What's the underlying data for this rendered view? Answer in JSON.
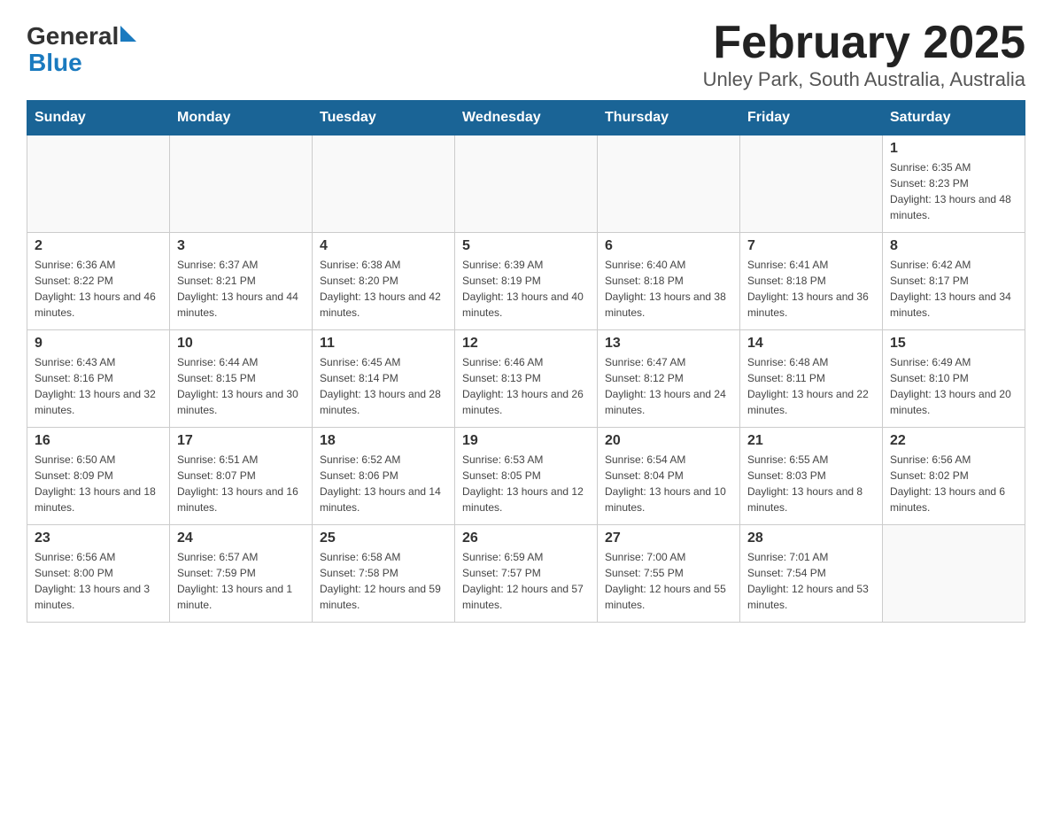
{
  "header": {
    "logo_general": "General",
    "logo_blue": "Blue",
    "title": "February 2025",
    "subtitle": "Unley Park, South Australia, Australia"
  },
  "days_of_week": [
    "Sunday",
    "Monday",
    "Tuesday",
    "Wednesday",
    "Thursday",
    "Friday",
    "Saturday"
  ],
  "weeks": [
    [
      {
        "day": "",
        "info": ""
      },
      {
        "day": "",
        "info": ""
      },
      {
        "day": "",
        "info": ""
      },
      {
        "day": "",
        "info": ""
      },
      {
        "day": "",
        "info": ""
      },
      {
        "day": "",
        "info": ""
      },
      {
        "day": "1",
        "info": "Sunrise: 6:35 AM\nSunset: 8:23 PM\nDaylight: 13 hours and 48 minutes."
      }
    ],
    [
      {
        "day": "2",
        "info": "Sunrise: 6:36 AM\nSunset: 8:22 PM\nDaylight: 13 hours and 46 minutes."
      },
      {
        "day": "3",
        "info": "Sunrise: 6:37 AM\nSunset: 8:21 PM\nDaylight: 13 hours and 44 minutes."
      },
      {
        "day": "4",
        "info": "Sunrise: 6:38 AM\nSunset: 8:20 PM\nDaylight: 13 hours and 42 minutes."
      },
      {
        "day": "5",
        "info": "Sunrise: 6:39 AM\nSunset: 8:19 PM\nDaylight: 13 hours and 40 minutes."
      },
      {
        "day": "6",
        "info": "Sunrise: 6:40 AM\nSunset: 8:18 PM\nDaylight: 13 hours and 38 minutes."
      },
      {
        "day": "7",
        "info": "Sunrise: 6:41 AM\nSunset: 8:18 PM\nDaylight: 13 hours and 36 minutes."
      },
      {
        "day": "8",
        "info": "Sunrise: 6:42 AM\nSunset: 8:17 PM\nDaylight: 13 hours and 34 minutes."
      }
    ],
    [
      {
        "day": "9",
        "info": "Sunrise: 6:43 AM\nSunset: 8:16 PM\nDaylight: 13 hours and 32 minutes."
      },
      {
        "day": "10",
        "info": "Sunrise: 6:44 AM\nSunset: 8:15 PM\nDaylight: 13 hours and 30 minutes."
      },
      {
        "day": "11",
        "info": "Sunrise: 6:45 AM\nSunset: 8:14 PM\nDaylight: 13 hours and 28 minutes."
      },
      {
        "day": "12",
        "info": "Sunrise: 6:46 AM\nSunset: 8:13 PM\nDaylight: 13 hours and 26 minutes."
      },
      {
        "day": "13",
        "info": "Sunrise: 6:47 AM\nSunset: 8:12 PM\nDaylight: 13 hours and 24 minutes."
      },
      {
        "day": "14",
        "info": "Sunrise: 6:48 AM\nSunset: 8:11 PM\nDaylight: 13 hours and 22 minutes."
      },
      {
        "day": "15",
        "info": "Sunrise: 6:49 AM\nSunset: 8:10 PM\nDaylight: 13 hours and 20 minutes."
      }
    ],
    [
      {
        "day": "16",
        "info": "Sunrise: 6:50 AM\nSunset: 8:09 PM\nDaylight: 13 hours and 18 minutes."
      },
      {
        "day": "17",
        "info": "Sunrise: 6:51 AM\nSunset: 8:07 PM\nDaylight: 13 hours and 16 minutes."
      },
      {
        "day": "18",
        "info": "Sunrise: 6:52 AM\nSunset: 8:06 PM\nDaylight: 13 hours and 14 minutes."
      },
      {
        "day": "19",
        "info": "Sunrise: 6:53 AM\nSunset: 8:05 PM\nDaylight: 13 hours and 12 minutes."
      },
      {
        "day": "20",
        "info": "Sunrise: 6:54 AM\nSunset: 8:04 PM\nDaylight: 13 hours and 10 minutes."
      },
      {
        "day": "21",
        "info": "Sunrise: 6:55 AM\nSunset: 8:03 PM\nDaylight: 13 hours and 8 minutes."
      },
      {
        "day": "22",
        "info": "Sunrise: 6:56 AM\nSunset: 8:02 PM\nDaylight: 13 hours and 6 minutes."
      }
    ],
    [
      {
        "day": "23",
        "info": "Sunrise: 6:56 AM\nSunset: 8:00 PM\nDaylight: 13 hours and 3 minutes."
      },
      {
        "day": "24",
        "info": "Sunrise: 6:57 AM\nSunset: 7:59 PM\nDaylight: 13 hours and 1 minute."
      },
      {
        "day": "25",
        "info": "Sunrise: 6:58 AM\nSunset: 7:58 PM\nDaylight: 12 hours and 59 minutes."
      },
      {
        "day": "26",
        "info": "Sunrise: 6:59 AM\nSunset: 7:57 PM\nDaylight: 12 hours and 57 minutes."
      },
      {
        "day": "27",
        "info": "Sunrise: 7:00 AM\nSunset: 7:55 PM\nDaylight: 12 hours and 55 minutes."
      },
      {
        "day": "28",
        "info": "Sunrise: 7:01 AM\nSunset: 7:54 PM\nDaylight: 12 hours and 53 minutes."
      },
      {
        "day": "",
        "info": ""
      }
    ]
  ]
}
